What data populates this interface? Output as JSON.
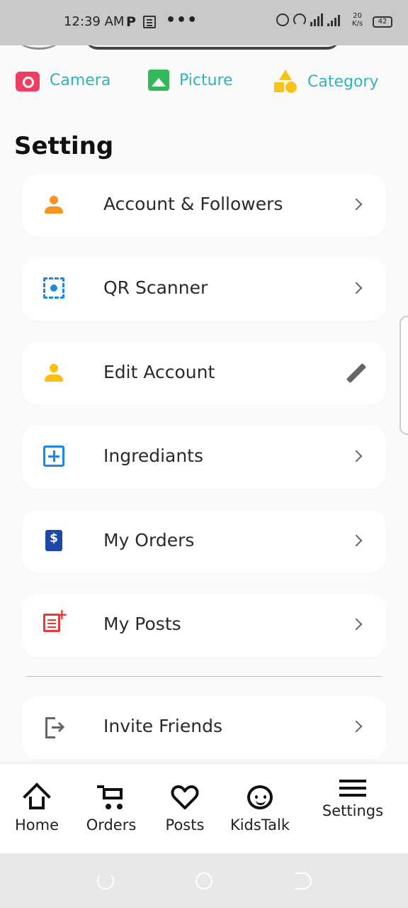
{
  "status_bar": {
    "time": "12:39 AM",
    "p_label": "P",
    "dots": "•••",
    "net_speed_top": "20",
    "net_speed_bottom": "K/s",
    "battery": "42"
  },
  "quick_actions": [
    {
      "label": "Camera",
      "icon": "camera-icon",
      "color": "#ee3f63"
    },
    {
      "label": "Picture",
      "icon": "picture-icon",
      "color": "#33b85a"
    },
    {
      "label": "Category",
      "icon": "category-icon",
      "color": "#f7c31b"
    }
  ],
  "section_title": "Setting",
  "settings": [
    {
      "label": "Account & Followers",
      "icon": "person-icon",
      "icon_color": "#f7931e",
      "trailing": "chevron-right-icon"
    },
    {
      "label": "QR Scanner",
      "icon": "qr-scan-icon",
      "icon_color": "#1e88e5",
      "trailing": "chevron-right-icon"
    },
    {
      "label": "Edit Account",
      "icon": "person-icon",
      "icon_color": "#f9c00f",
      "trailing": "pencil-icon"
    },
    {
      "label": "Ingrediants",
      "icon": "plus-box-icon",
      "icon_color": "#1e88e5",
      "trailing": "chevron-right-icon"
    },
    {
      "label": "My Orders",
      "icon": "invoice-icon",
      "icon_color": "#1d47a8",
      "trailing": "chevron-right-icon"
    },
    {
      "label": "My Posts",
      "icon": "post-add-icon",
      "icon_color": "#e53935",
      "trailing": "chevron-right-icon"
    },
    {
      "label": "Invite Friends",
      "icon": "exit-icon",
      "icon_color": "#666666",
      "trailing": "chevron-right-icon"
    }
  ],
  "invoice_symbol": "$",
  "bottom_nav": [
    {
      "label": "Home",
      "icon": "home-icon"
    },
    {
      "label": "Orders",
      "icon": "cart-icon"
    },
    {
      "label": "Posts",
      "icon": "heart-icon"
    },
    {
      "label": "KidsTalk",
      "icon": "kid-face-icon"
    },
    {
      "label": "Settings",
      "icon": "menu-icon"
    }
  ],
  "colors": {
    "accent_text": "#2fb5b9",
    "background": "#fafafa",
    "card": "#ffffff"
  }
}
